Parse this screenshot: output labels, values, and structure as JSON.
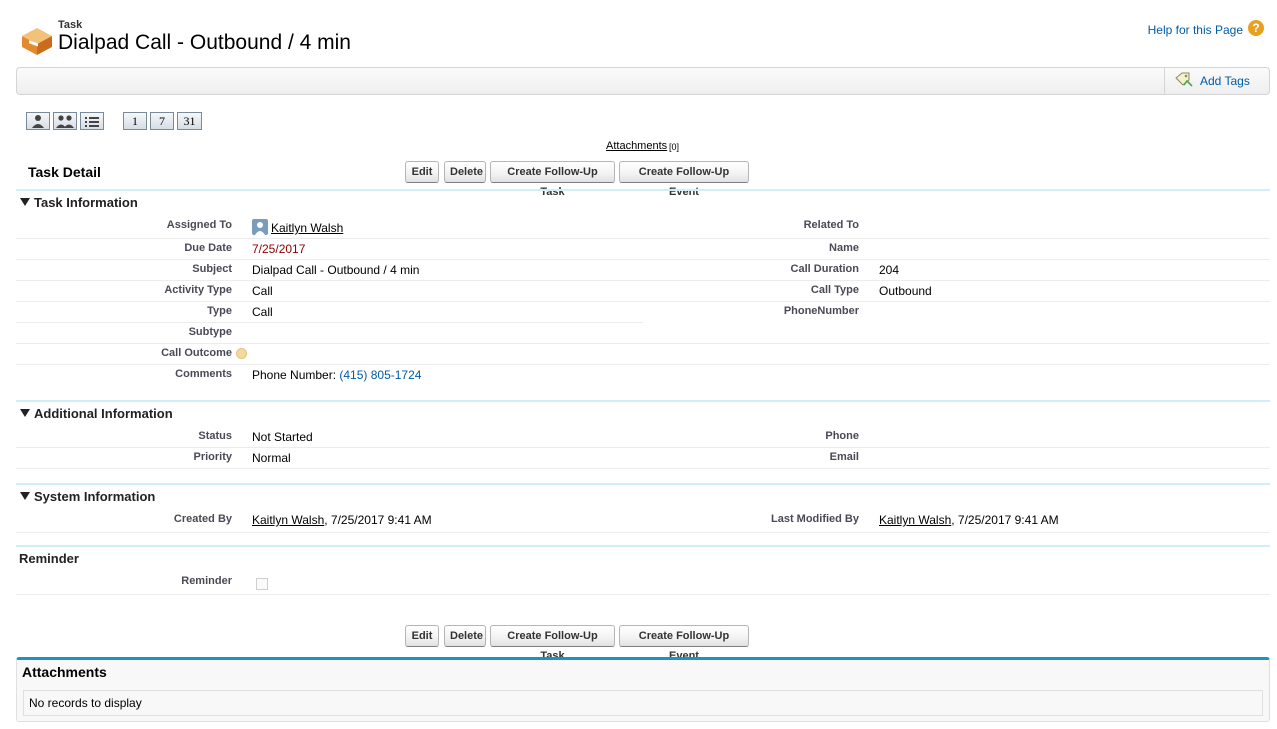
{
  "header": {
    "type_label": "Task",
    "title": "Dialpad Call - Outbound / 4 min",
    "help_link": "Help for this Page",
    "help_icon": "?"
  },
  "tag_bar": {
    "add_tags_label": "Add Tags"
  },
  "view_buttons": {
    "icons": [
      "single-user-icon",
      "multi-user-icon",
      "list-view-icon"
    ],
    "day_label": "1",
    "week_label": "7",
    "month_label": "31"
  },
  "attachments_link": {
    "label": "Attachments",
    "count": "[0]"
  },
  "detail": {
    "title": "Task Detail",
    "buttons": {
      "edit": "Edit",
      "delete": "Delete",
      "follow_up_task": "Create Follow-Up Task",
      "follow_up_event": "Create Follow-Up Event"
    }
  },
  "task_info": {
    "title": "Task Information",
    "assigned_to_label": "Assigned To",
    "assigned_to_value": "Kaitlyn Walsh",
    "due_date_label": "Due Date",
    "due_date_value": "7/25/2017",
    "subject_label": "Subject",
    "subject_value": "Dialpad Call - Outbound / 4 min",
    "activity_type_label": "Activity Type",
    "activity_type_value": "Call",
    "type_label": "Type",
    "type_value": "Call",
    "subtype_label": "Subtype",
    "subtype_value": "",
    "call_outcome_label": "Call Outcome",
    "call_outcome_value": "",
    "comments_label": "Comments",
    "comments_prefix": "Phone Number: ",
    "comments_phone": "(415) 805-1724",
    "related_to_label": "Related To",
    "related_to_value": "",
    "name_label": "Name",
    "name_value": "",
    "call_duration_label": "Call Duration",
    "call_duration_value": "204",
    "call_type_label": "Call Type",
    "call_type_value": "Outbound",
    "phone_number_label": "PhoneNumber",
    "phone_number_value": ""
  },
  "additional_info": {
    "title": "Additional Information",
    "status_label": "Status",
    "status_value": "Not Started",
    "priority_label": "Priority",
    "priority_value": "Normal",
    "phone_label": "Phone",
    "phone_value": "",
    "email_label": "Email",
    "email_value": ""
  },
  "system_info": {
    "title": "System Information",
    "created_by_label": "Created By",
    "created_by_user": "Kaitlyn Walsh",
    "created_by_date": ", 7/25/2017 9:41 AM",
    "last_modified_label": "Last Modified By",
    "last_modified_user": "Kaitlyn Walsh",
    "last_modified_date": ", 7/25/2017 9:41 AM"
  },
  "reminder": {
    "title": "Reminder",
    "reminder_label": "Reminder",
    "checked": false
  },
  "attachments_list": {
    "title": "Attachments",
    "empty_text": "No records to display"
  },
  "colors": {
    "link_blue": "#015ba7",
    "section_rule": "#cfeef8",
    "panel_accent": "#1797c0",
    "due_date": "#8b0000"
  }
}
